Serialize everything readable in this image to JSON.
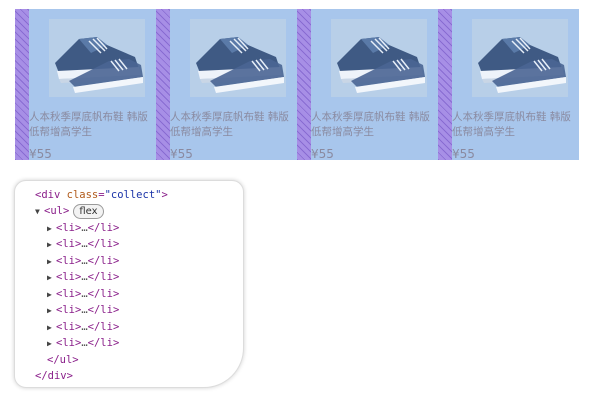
{
  "products": [
    {
      "title": "人本秋季厚底帆布鞋 韩版低帮增高学生",
      "price": "¥55"
    },
    {
      "title": "人本秋季厚底帆布鞋 韩版低帮增高学生",
      "price": "¥55"
    },
    {
      "title": "人本秋季厚底帆布鞋 韩版低帮增高学生",
      "price": "¥55"
    },
    {
      "title": "人本秋季厚底帆布鞋 韩版低帮增高学生",
      "price": "¥55"
    }
  ],
  "devtools": {
    "div_open_tag": "div",
    "div_class_attr": "class",
    "div_class_value": "\"collect\"",
    "ul_tag": "ul",
    "ul_badge": "flex",
    "li_tag": "li",
    "li_ellipsis": "…",
    "li_count": 8,
    "ul_close": "</ul>",
    "div_close": "</div>"
  },
  "colors": {
    "card_overlay": "#a8c6ec",
    "gap_overlay": "#a78fe6",
    "tag_color": "#8a1f8a",
    "attr_color": "#b05a1a",
    "value_color": "#1a33a8"
  }
}
